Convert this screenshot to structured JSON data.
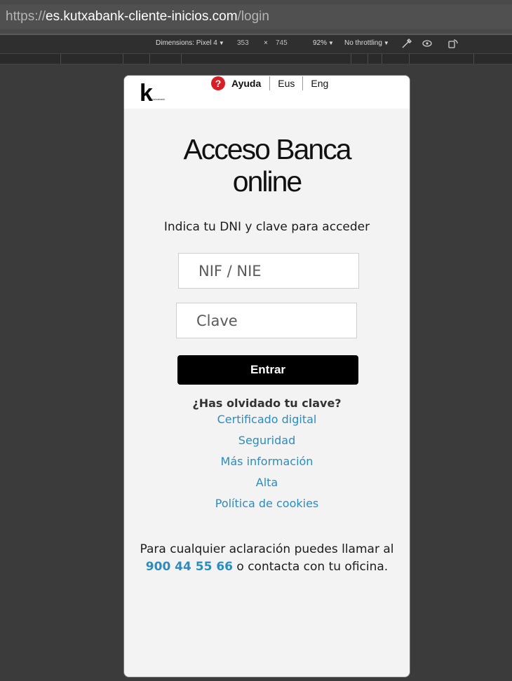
{
  "browser": {
    "url_scheme": "https://",
    "url_host": "es.kutxabank-cliente-inicios.com",
    "url_path": "/login"
  },
  "devtools": {
    "dimensions_label": "Dimensions: Pixel 4",
    "width": "353",
    "times": "×",
    "height": "745",
    "zoom": "92%",
    "throttling": "No throttling",
    "icons": [
      "eyedropper-icon",
      "eye-icon",
      "rotate-device-icon"
    ]
  },
  "header": {
    "logo_letter": "k",
    "logo_wordmark": "kutxabank",
    "help_icon": "?",
    "help_label": "Ayuda",
    "languages": [
      "Eus",
      "Eng"
    ]
  },
  "login": {
    "title_line1": "Acceso Banca",
    "title_line2": "online",
    "subtitle": "Indica tu DNI y clave para acceder",
    "nif_placeholder": "NIF / NIE",
    "password_placeholder": "Clave",
    "submit_label": "Entrar",
    "forgot_label": "¿Has olvidado tu clave?",
    "links": [
      "Certificado digital",
      "Seguridad",
      "Más información",
      "Alta",
      "Política de cookies"
    ]
  },
  "contact": {
    "text_before": "Para cualquier aclaración puedes llamar al",
    "phone": "900 44 55 66",
    "text_after": "o contacta con tu oficina."
  },
  "colors": {
    "link": "#2b8cbf",
    "button": "#000000",
    "help_icon": "#d81f26"
  }
}
